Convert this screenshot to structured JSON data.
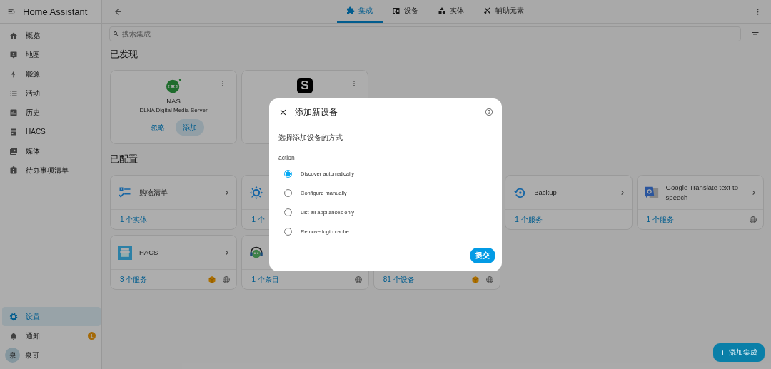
{
  "sidebar": {
    "title": "Home Assistant",
    "items": [
      {
        "kind": "home",
        "label": "概览",
        "selected": false
      },
      {
        "kind": "map",
        "label": "地图",
        "selected": false
      },
      {
        "kind": "energy",
        "label": "能源",
        "selected": false
      },
      {
        "kind": "logbook",
        "label": "活动",
        "selected": false
      },
      {
        "kind": "history",
        "label": "历史",
        "selected": false
      },
      {
        "kind": "hacs",
        "label": "HACS",
        "selected": false
      },
      {
        "kind": "media",
        "label": "媒体",
        "selected": false
      },
      {
        "kind": "todo",
        "label": "待办事项清单",
        "selected": false
      }
    ],
    "bottom_items": [
      {
        "kind": "settings",
        "label": "设置",
        "selected": true
      },
      {
        "kind": "notifications",
        "label": "通知",
        "selected": false,
        "badge": "1"
      },
      {
        "kind": "user",
        "label": "泉哥",
        "selected": false,
        "avatar": "泉"
      }
    ]
  },
  "tabs": [
    {
      "kind": "integrations",
      "label": "集成",
      "selected": true
    },
    {
      "kind": "devices",
      "label": "设备",
      "selected": false
    },
    {
      "kind": "entities",
      "label": "实体",
      "selected": false
    },
    {
      "kind": "helpers",
      "label": "辅助元素",
      "selected": false
    }
  ],
  "search": {
    "placeholder": "搜索集成"
  },
  "discovered": {
    "heading": "已发现",
    "cards": [
      {
        "kind": "dlna",
        "name": "NAS",
        "subtitle": "DLNA Digital Media Server",
        "actions": [
          {
            "label": "忽略",
            "kind": "text"
          },
          {
            "label": "添加",
            "kind": "tonal"
          }
        ]
      },
      {
        "kind": "letter",
        "logo_text": "S"
      }
    ]
  },
  "configured": {
    "heading": "已配置",
    "rows": [
      [
        {
          "kind": "shopping",
          "name": "购物清单",
          "footer": "1 个实体",
          "custom": false,
          "cloud": false
        },
        {
          "kind": "sun",
          "footer": "1 个"
        },
        {
          "kind": "backup",
          "name": "Backup",
          "footer": "1 个服务",
          "custom": false,
          "cloud": false
        },
        {
          "kind": "translate",
          "name": "Google Translate text-to-speech",
          "footer": "1 个服务",
          "custom": false,
          "cloud": true
        }
      ],
      [
        {
          "kind": "hacs",
          "name": "HACS",
          "footer": "3 个服务",
          "custom": true,
          "cloud": true
        },
        {
          "kind": "music",
          "footer": "1 个条目",
          "custom": false,
          "cloud": true
        },
        {
          "kind": "blank",
          "footer": "81 个设备",
          "custom": true,
          "cloud": true
        }
      ]
    ]
  },
  "dialog": {
    "title": "添加新设备",
    "description": "选择添加设备的方式",
    "field_label": "action",
    "options": [
      {
        "label": "Discover automatically",
        "selected": true
      },
      {
        "label": "Configure manually",
        "selected": false
      },
      {
        "label": "List all appliances only",
        "selected": false
      },
      {
        "label": "Remove login cache",
        "selected": false
      }
    ],
    "submit": "提交"
  },
  "fab": {
    "label": "添加集成"
  }
}
